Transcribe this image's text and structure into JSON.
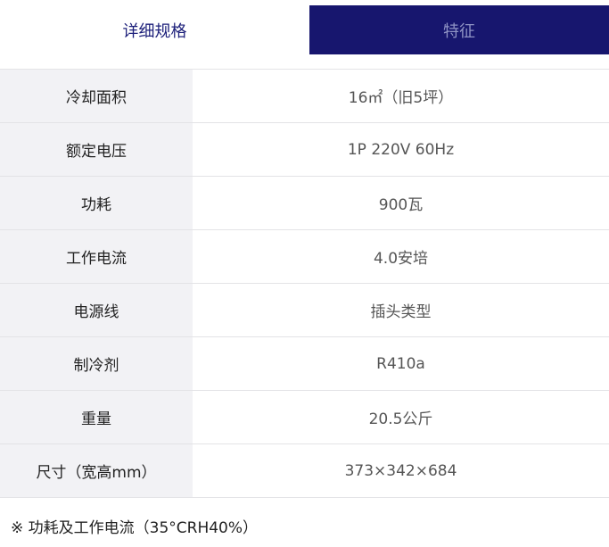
{
  "tabs": {
    "details": "详细规格",
    "features": "特征"
  },
  "specs": [
    {
      "label": "冷却面积",
      "value": "16㎡（旧5坪）"
    },
    {
      "label": "额定电压",
      "value": "1P 220V 60Hz"
    },
    {
      "label": "功耗",
      "value": "900瓦"
    },
    {
      "label": "工作电流",
      "value": "4.0安培"
    },
    {
      "label": "电源线",
      "value": "插头类型"
    },
    {
      "label": "制冷剂",
      "value": "R410a"
    },
    {
      "label": "重量",
      "value": "20.5公斤"
    },
    {
      "label": "尺寸（宽高mm）",
      "value": "373×342×684"
    }
  ],
  "footnote": "※ 功耗及工作电流（35°CRH40%）",
  "colors": {
    "active_tab_text": "#1c1f7a",
    "inactive_tab_bg": "#17166e",
    "label_bg": "#f2f2f5"
  }
}
